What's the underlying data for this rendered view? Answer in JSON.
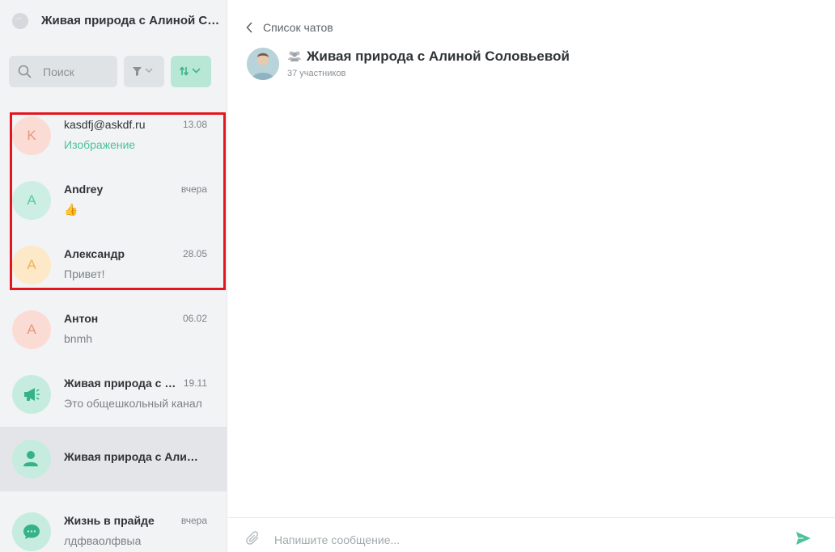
{
  "sidebar": {
    "title": "Живая природа с Алиной Соловьевой",
    "search_placeholder": "Поиск",
    "chats": [
      {
        "initial": "K",
        "name": "kasdfj@askdf.ru",
        "date": "13.08",
        "preview": "Изображение",
        "avatar_bg": "#fbdcd5",
        "avatar_fg": "#e8957c"
      },
      {
        "initial": "A",
        "name": "Andrey",
        "date": "вчера",
        "preview": "👍",
        "avatar_bg": "#cdeee3",
        "avatar_fg": "#5cc8a3"
      },
      {
        "initial": "A",
        "name": "Александр",
        "date": "28.05",
        "preview": "Привет!",
        "avatar_bg": "#fde8c8",
        "avatar_fg": "#f0b15c"
      },
      {
        "initial": "A",
        "name": "Антон",
        "date": "06.02",
        "preview": "bnmh",
        "avatar_bg": "#fbdcd5",
        "avatar_fg": "#e8957c"
      },
      {
        "icon": "megaphone-icon",
        "name": "Живая природа с Алиной Соловьевой",
        "date": "19.11",
        "preview": "Это общешкольный канал",
        "avatar_bg": "#c5ecdf"
      },
      {
        "icon": "user-icon",
        "name": "Живая природа с Алиной Соловьевой",
        "avatar_bg": "#c5ecdf"
      },
      {
        "icon": "chat-bubble-icon",
        "name": "Жизнь в прайде",
        "date": "вчера",
        "preview": "лдфваолфвыа",
        "avatar_bg": "#c5ecdf"
      }
    ]
  },
  "main": {
    "back_label": "Список чатов",
    "chat_title": "Живая природа с Алиной Соловьевой",
    "members": "37 участников",
    "composer_placeholder": "Напишите сообщение..."
  },
  "colors": {
    "accent": "#4cc29a",
    "highlight": "#e3161f"
  }
}
